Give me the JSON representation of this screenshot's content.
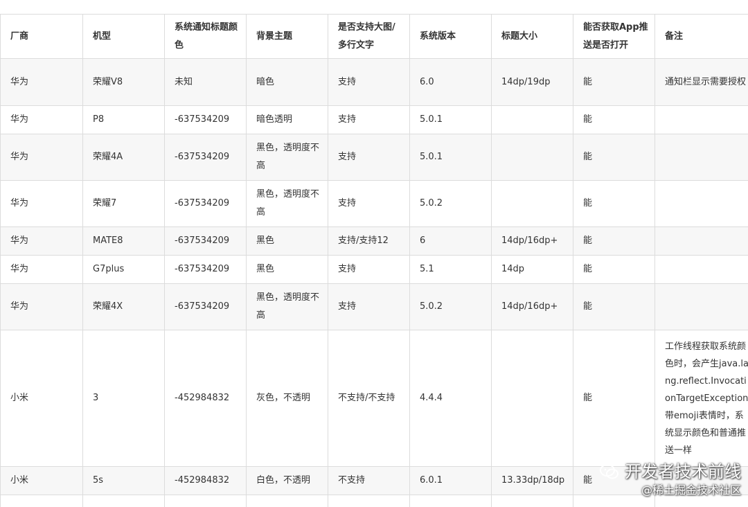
{
  "table": {
    "headers": [
      "厂商",
      "机型",
      "系统通知标题颜色",
      "背景主题",
      "是否支持大图/多行文字",
      "系统版本",
      "标题大小",
      "能否获取App推送是否打开",
      "备注"
    ],
    "rows": [
      [
        "华为",
        "荣耀V8",
        "未知",
        "暗色",
        "支持",
        "6.0",
        "14dp/19dp",
        "能",
        "通知栏显示需要授权"
      ],
      [
        "华为",
        "P8",
        "-637534209",
        "暗色透明",
        "支持",
        "5.0.1",
        "",
        "能",
        ""
      ],
      [
        "华为",
        "荣耀4A",
        "-637534209",
        "黑色，透明度不高",
        "支持",
        "5.0.1",
        "",
        "能",
        ""
      ],
      [
        "华为",
        "荣耀7",
        "-637534209",
        "黑色，透明度不高",
        "支持",
        "5.0.2",
        "",
        "能",
        ""
      ],
      [
        "华为",
        "MATE8",
        "-637534209",
        "黑色",
        "支持/支持12",
        "6",
        "14dp/16dp+",
        "能",
        ""
      ],
      [
        "华为",
        "G7plus",
        "-637534209",
        "黑色",
        "支持",
        "5.1",
        "14dp",
        "能",
        ""
      ],
      [
        "华为",
        "荣耀4X",
        "-637534209",
        "黑色，透明度不高",
        "支持",
        "5.0.2",
        "14dp/16dp+",
        "能",
        ""
      ],
      [
        "小米",
        "3",
        "-452984832",
        "灰色，不透明",
        "不支持/不支持",
        "4.4.4",
        "",
        "能",
        "工作线程获取系统颜色时，会产生java.lang.reflect.InvocationTargetException 带emoji表情时，系统显示颜色和普通推送一样"
      ],
      [
        "小米",
        "5s",
        "-452984832",
        "白色，不透明",
        "不支持",
        "6.0.1",
        "13.33dp/18dp",
        "能",
        ""
      ],
      [
        "",
        "",
        "",
        "",
        "",
        "",
        "",
        "",
        ""
      ]
    ]
  },
  "watermark": {
    "line1": "开发者技术前线",
    "line2": "@稀土掘金技术社区",
    "icon": "wechat-icon"
  }
}
